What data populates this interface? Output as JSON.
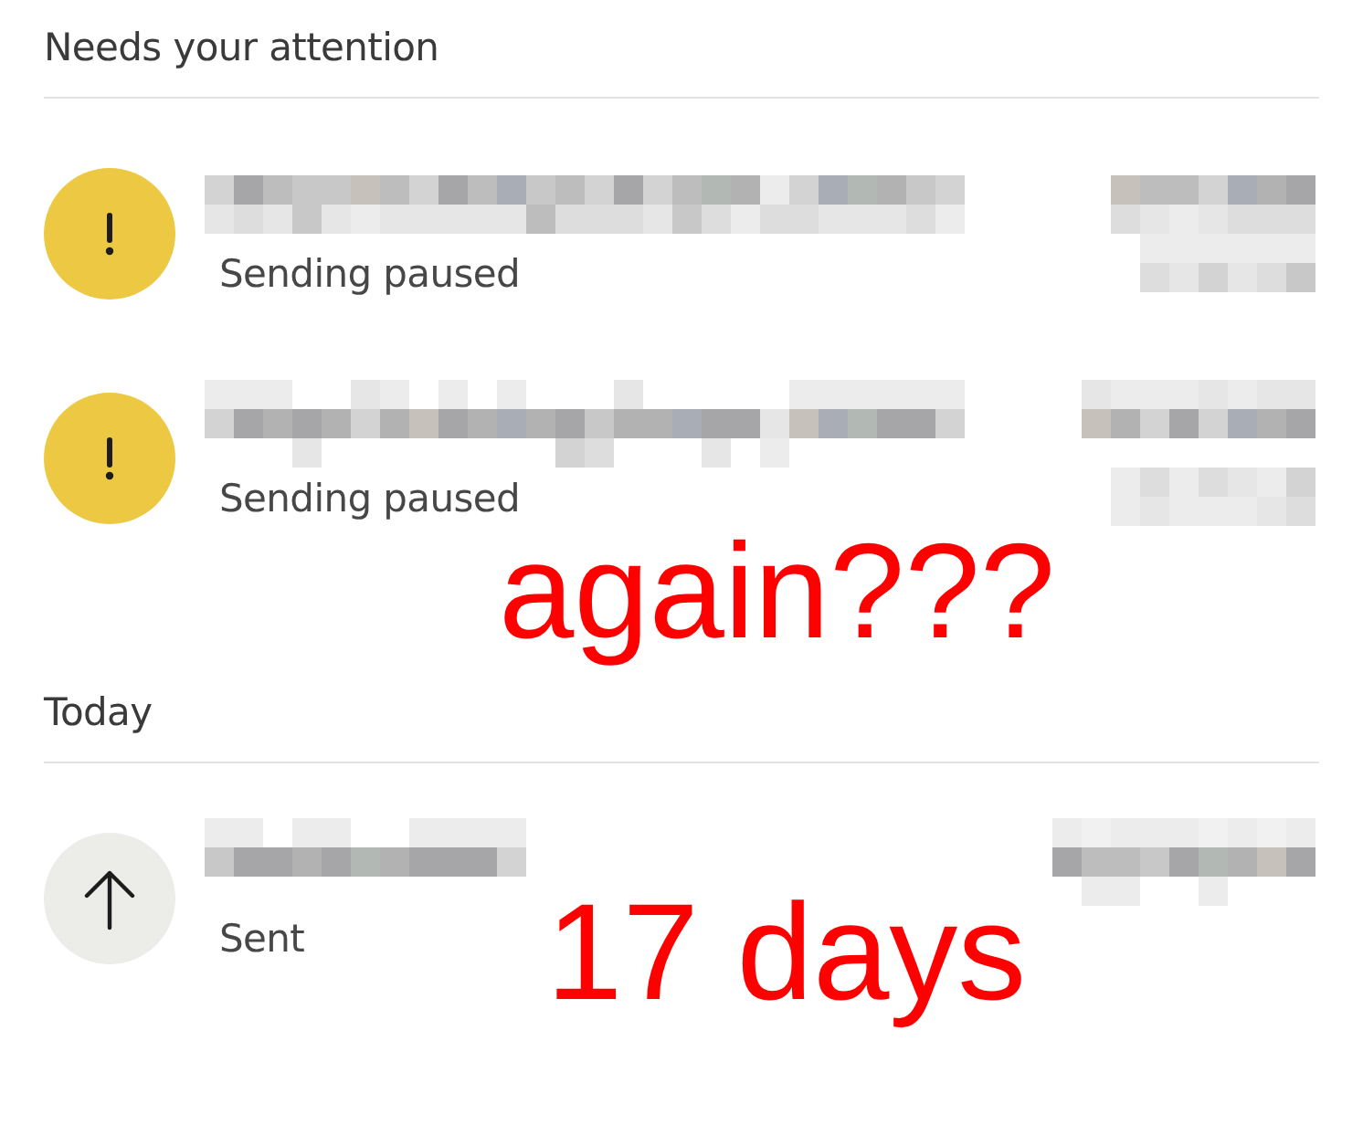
{
  "sections": [
    {
      "heading": "Needs your attention",
      "items": [
        {
          "kind": "paused",
          "status": "Sending paused",
          "text_redacted": true,
          "side_redacted": true
        },
        {
          "kind": "paused",
          "status": "Sending paused",
          "text_redacted": true,
          "side_redacted": true
        }
      ]
    },
    {
      "heading": "Today",
      "items": [
        {
          "kind": "sent",
          "status": "Sent",
          "text_redacted": true,
          "side_redacted": true
        }
      ]
    }
  ],
  "annotations": [
    {
      "text": "again???"
    },
    {
      "text": "17 days"
    }
  ]
}
